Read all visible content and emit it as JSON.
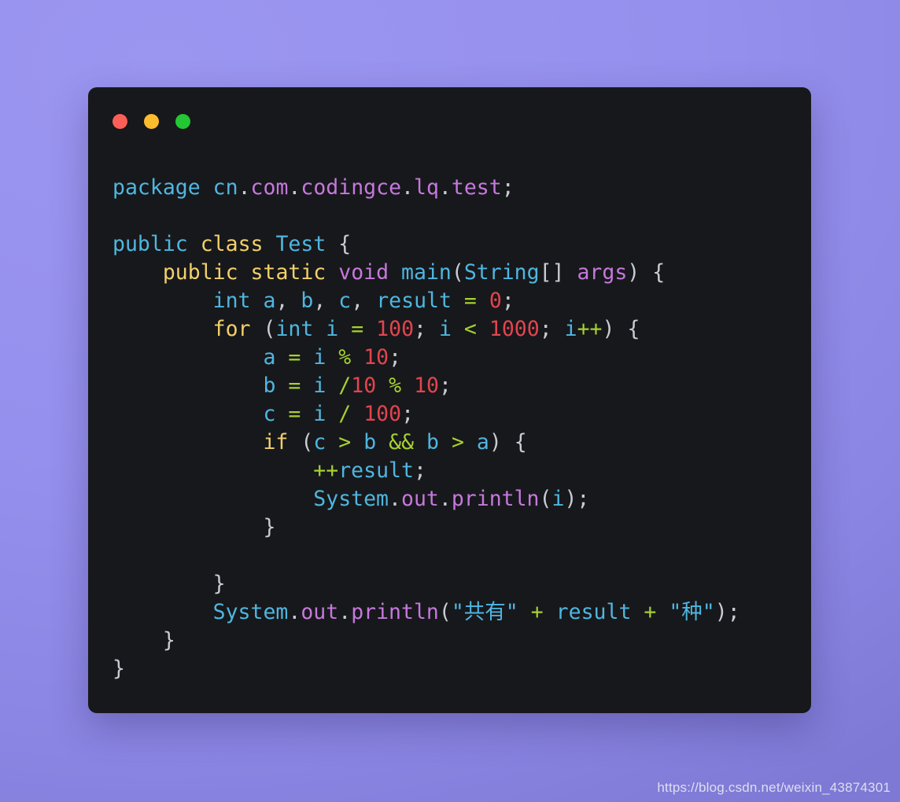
{
  "window": {
    "traffic_lights": [
      {
        "name": "close",
        "color": "#fc5f57"
      },
      {
        "name": "minimize",
        "color": "#fdbc2e"
      },
      {
        "name": "zoom",
        "color": "#25c634"
      }
    ],
    "background_color": "#17181b"
  },
  "page": {
    "background_color": "#9590ed"
  },
  "code": {
    "language": "java",
    "lines": [
      "package cn.com.codingce.lq.test;",
      "",
      "public class Test {",
      "    public static void main(String[] args) {",
      "        int a, b, c, result = 0;",
      "        for (int i = 100; i < 1000; i++) {",
      "            a = i % 10;",
      "            b = i /10 % 10;",
      "            c = i / 100;",
      "            if (c > b && b > a) {",
      "                ++result;",
      "                System.out.println(i);",
      "            }",
      "",
      "        }",
      "        System.out.println(\"共有\" + result + \"种\");",
      "    }",
      "}"
    ],
    "colors": {
      "keyword": "#f2d06b",
      "identifier": "#4fb6e0",
      "member": "#c678dd",
      "number": "#e2444f",
      "operator": "#a7d130",
      "punctuation": "#c8ccd2",
      "string": "#4fb6e0"
    }
  },
  "watermark": {
    "text": "https://blog.csdn.net/weixin_43874301"
  }
}
